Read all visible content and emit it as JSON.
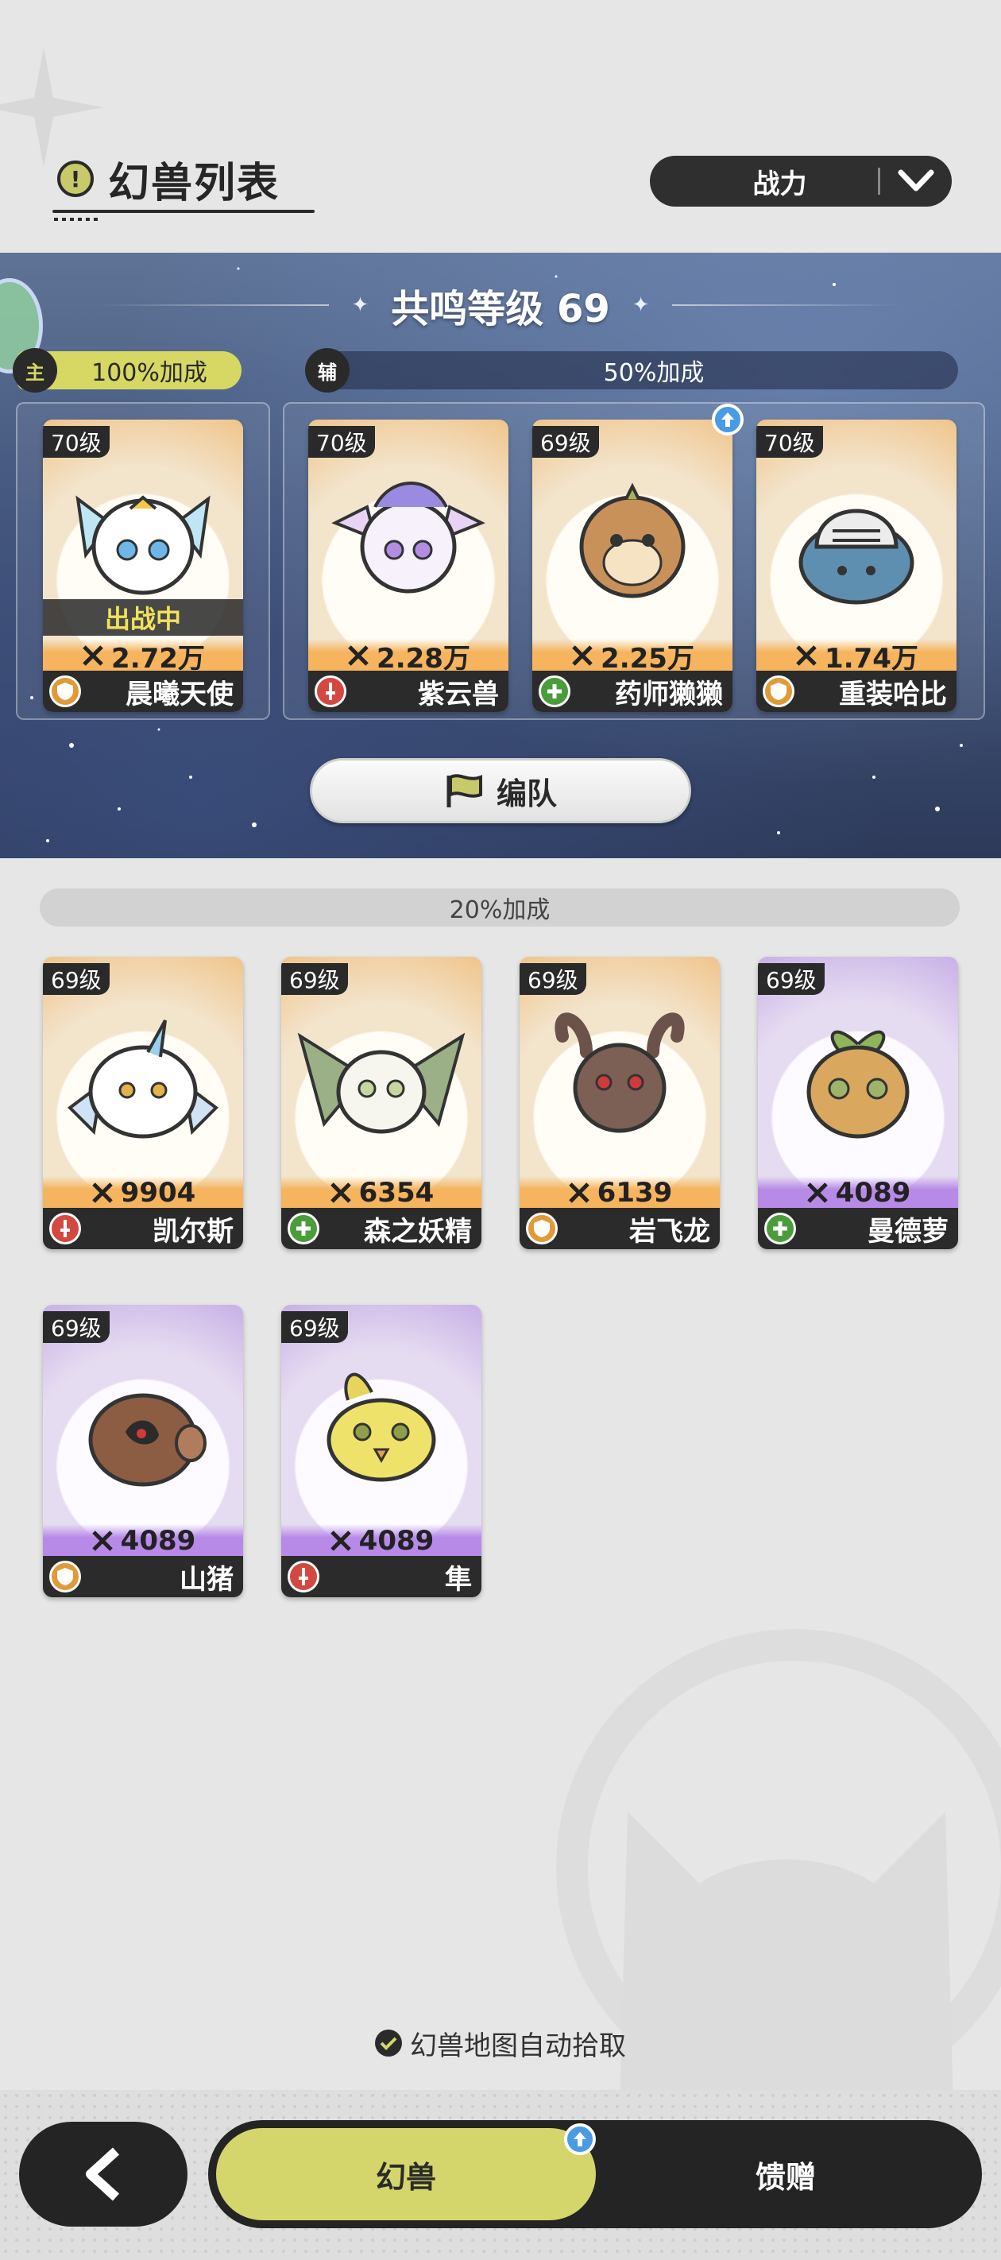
{
  "header": {
    "title": "幻兽列表",
    "title_icon": "exclamation-icon",
    "sort_label": "战力"
  },
  "team": {
    "resonance_label": "共鸣等级 69",
    "main_tag": "主",
    "main_bonus": "100%加成",
    "support_tag": "辅",
    "support_bonus": "50%加成",
    "deploy_label": "出战中",
    "formation_label": "编队",
    "cards": [
      {
        "level": "70级",
        "power": "2.72万",
        "name": "晨曦天使",
        "role": "defense",
        "theme": "orange"
      },
      {
        "level": "70级",
        "power": "2.28万",
        "name": "紫云兽",
        "role": "attack",
        "theme": "orange"
      },
      {
        "level": "69级",
        "power": "2.25万",
        "name": "药师獭獭",
        "role": "heal",
        "theme": "orange"
      },
      {
        "level": "70级",
        "power": "1.74万",
        "name": "重装哈比",
        "role": "defense",
        "theme": "orange"
      }
    ]
  },
  "bench": {
    "bonus": "20%加成",
    "cards": [
      {
        "level": "69级",
        "power": "9904",
        "name": "凯尔斯",
        "role": "attack",
        "theme": "orange"
      },
      {
        "level": "69级",
        "power": "6354",
        "name": "森之妖精",
        "role": "heal",
        "theme": "orange"
      },
      {
        "level": "69级",
        "power": "6139",
        "name": "岩飞龙",
        "role": "defense",
        "theme": "orange"
      },
      {
        "level": "69级",
        "power": "4089",
        "name": "曼德萝",
        "role": "heal",
        "theme": "purple"
      },
      {
        "level": "69级",
        "power": "4089",
        "name": "山猪",
        "role": "defense",
        "theme": "purple"
      },
      {
        "level": "69级",
        "power": "4089",
        "name": "隼",
        "role": "attack",
        "theme": "purple"
      }
    ]
  },
  "footer": {
    "auto_pick_label": "幻兽地图自动拾取",
    "tabs": [
      "幻兽",
      "馈赠"
    ]
  },
  "colors": {
    "accent": "#d4d66c",
    "dark": "#242424",
    "orange": "#f5b45d",
    "purple": "#b88ae8"
  }
}
